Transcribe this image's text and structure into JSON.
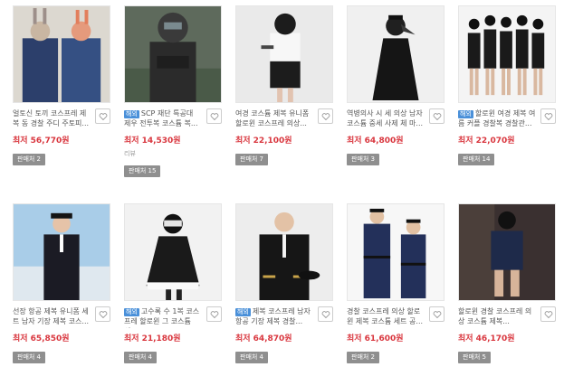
{
  "products": [
    {
      "title": "얼토신 토끼 코스프레 제복 동 경찰 주디 주토피...",
      "badge": "",
      "price_label": "최저",
      "price": "56,770원",
      "review": "",
      "seller_label": "판매처 2"
    },
    {
      "title": "SCP 재단 특공대 제우 전투복 코스튬 복...",
      "badge": "해외",
      "price_label": "최저",
      "price": "14,530원",
      "review": "리뷰",
      "seller_label": "판매처 15"
    },
    {
      "title": "여경 코스튬 제복 유니폼 할로윈 코스프레 의상...",
      "badge": "",
      "price_label": "최저",
      "price": "22,100원",
      "review": "",
      "seller_label": "판매처 7"
    },
    {
      "title": "역병의사 시 세 의상 남자코스튬 중세 사제 체 마...",
      "badge": "",
      "price_label": "최저",
      "price": "64,800원",
      "review": "",
      "seller_label": "판매처 3"
    },
    {
      "title": "할로윈 여경 제복 여름 커플 경찰복 경찰관...",
      "badge": "해외",
      "price_label": "최저",
      "price": "22,070원",
      "review": "",
      "seller_label": "판매처 14"
    },
    {
      "title": "선장 항공 제복 유니폼 세트 남자 기장 제복 코스...",
      "badge": "",
      "price_label": "최저",
      "price": "65,850원",
      "review": "",
      "seller_label": "판매처 4"
    },
    {
      "title": "고수록 수 1복 코스프레 할로윈 그 코스튬 의...",
      "badge": "해외",
      "price_label": "최저",
      "price": "21,180원",
      "review": "",
      "seller_label": "판매처 4"
    },
    {
      "title": "제복 코스프레 남자 항공 기장 제복 경찰...",
      "badge": "해외",
      "price_label": "최저",
      "price": "64,870원",
      "review": "",
      "seller_label": "판매처 4"
    },
    {
      "title": "경찰 코스프레 의상 할로윈 제복 코스튬 세트 공...",
      "badge": "",
      "price_label": "최저",
      "price": "61,600원",
      "review": "",
      "seller_label": "판매처 2"
    },
    {
      "title": "할로윈 경찰 코스프레 의상 코스튬 제복...",
      "badge": "",
      "price_label": "최저",
      "price": "46,170원",
      "review": "",
      "seller_label": "판매처 5"
    }
  ]
}
